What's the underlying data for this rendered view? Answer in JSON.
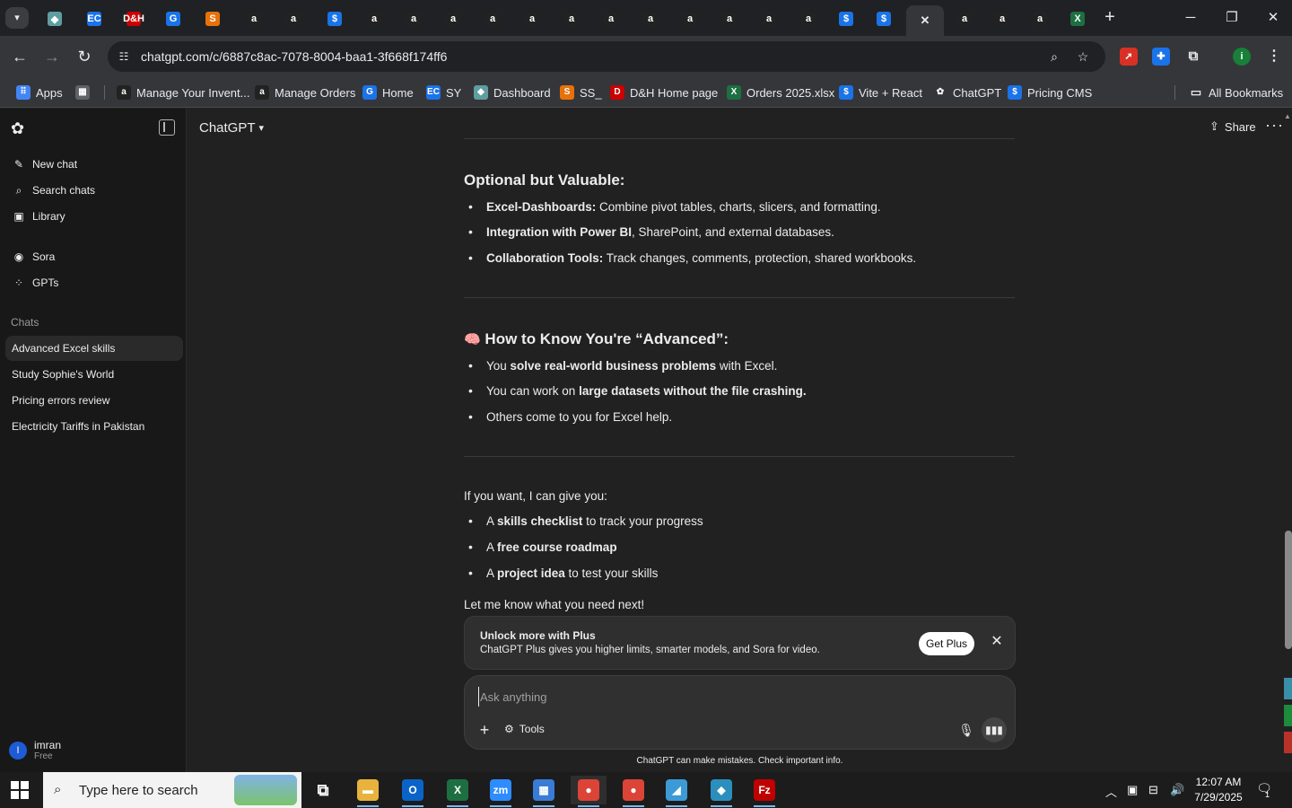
{
  "browser": {
    "url": "chatgpt.com/c/6887c8ac-7078-8004-baa1-3f668f174ff6",
    "tab_menu_icon": "chevron-down-icon",
    "new_tab_label": "+",
    "tabs": [
      {
        "icon": "app-icon",
        "label": "◆",
        "color": "#5f9ea0"
      },
      {
        "icon": "ec-icon",
        "label": "EC",
        "color": "#1a73e8"
      },
      {
        "icon": "dh-icon",
        "label": "D&H",
        "color": "#c00"
      },
      {
        "icon": "app-icon",
        "label": "G",
        "color": "#1a73e8"
      },
      {
        "icon": "app-icon",
        "label": "S",
        "color": "#e8710a"
      },
      {
        "icon": "amazon-icon",
        "label": "a",
        "color": "#222"
      },
      {
        "icon": "amazon-icon",
        "label": "a",
        "color": "#222"
      },
      {
        "icon": "dollar-icon",
        "label": "$",
        "color": "#1a73e8"
      },
      {
        "icon": "amazon-icon",
        "label": "a",
        "color": "#222"
      },
      {
        "icon": "amazon-icon",
        "label": "a",
        "color": "#222"
      },
      {
        "icon": "amazon-icon",
        "label": "a",
        "color": "#222"
      },
      {
        "icon": "amazon-icon",
        "label": "a",
        "color": "#222"
      },
      {
        "icon": "amazon-icon",
        "label": "a",
        "color": "#222"
      },
      {
        "icon": "amazon-icon",
        "label": "a",
        "color": "#222"
      },
      {
        "icon": "amazon-icon",
        "label": "a",
        "color": "#222"
      },
      {
        "icon": "amazon-icon",
        "label": "a",
        "color": "#222"
      },
      {
        "icon": "amazon-icon",
        "label": "a",
        "color": "#222"
      },
      {
        "icon": "amazon-icon",
        "label": "a",
        "color": "#222"
      },
      {
        "icon": "amazon-icon",
        "label": "a",
        "color": "#222"
      },
      {
        "icon": "amazon-icon",
        "label": "a",
        "color": "#222"
      },
      {
        "icon": "dollar-icon",
        "label": "$",
        "color": "#1a73e8"
      },
      {
        "icon": "dollar-icon",
        "label": "$",
        "color": "#1a73e8"
      },
      {
        "icon": "close-icon",
        "label": "✕",
        "color": "#35363a",
        "active": true
      },
      {
        "icon": "amazon-icon",
        "label": "a",
        "color": "#222"
      },
      {
        "icon": "amazon-icon",
        "label": "a",
        "color": "#222"
      },
      {
        "icon": "amazon-icon",
        "label": "a",
        "color": "#222"
      },
      {
        "icon": "excel-icon",
        "label": "X",
        "color": "#1d6f42"
      }
    ],
    "bookmarks": [
      {
        "label": "Apps",
        "icon": "apps-grid-icon",
        "color": "#4285f4",
        "glyph": "⠿"
      },
      {
        "label": "",
        "icon": "tab-groups-icon",
        "color": "#5f6368",
        "glyph": "▦"
      },
      {
        "label": "Manage Your Invent...",
        "icon": "amazon-icon",
        "color": "#222",
        "glyph": "a"
      },
      {
        "label": "Manage Orders",
        "icon": "amazon-icon",
        "color": "#222",
        "glyph": "a"
      },
      {
        "label": "Home",
        "icon": "home-icon",
        "color": "#1a73e8",
        "glyph": "G"
      },
      {
        "label": "SY",
        "icon": "ec-icon",
        "color": "#1a73e8",
        "glyph": "EC"
      },
      {
        "label": "Dashboard",
        "icon": "dashboard-icon",
        "color": "#5f9ea0",
        "glyph": "◆"
      },
      {
        "label": "SS_",
        "icon": "app-icon",
        "color": "#e8710a",
        "glyph": "S"
      },
      {
        "label": "D&H Home page",
        "icon": "dh-icon",
        "color": "#c00",
        "glyph": "D"
      },
      {
        "label": "Orders 2025.xlsx",
        "icon": "excel-icon",
        "color": "#1d6f42",
        "glyph": "X"
      },
      {
        "label": "Vite + React",
        "icon": "dollar-icon",
        "color": "#1a73e8",
        "glyph": "$"
      },
      {
        "label": "ChatGPT",
        "icon": "chatgpt-icon",
        "color": "#35363a",
        "glyph": "✿"
      },
      {
        "label": "Pricing CMS",
        "icon": "dollar-icon",
        "color": "#1a73e8",
        "glyph": "$"
      }
    ],
    "all_bookmarks": "All Bookmarks"
  },
  "sidebar": {
    "nav": [
      {
        "label": "New chat",
        "icon": "edit-icon",
        "glyph": "✎"
      },
      {
        "label": "Search chats",
        "icon": "search-icon",
        "glyph": "⌕"
      },
      {
        "label": "Library",
        "icon": "library-icon",
        "glyph": "▣"
      },
      {
        "label": "Sora",
        "icon": "sora-icon",
        "glyph": "◉"
      },
      {
        "label": "GPTs",
        "icon": "gpts-icon",
        "glyph": "⁘"
      }
    ],
    "chats_heading": "Chats",
    "chats": [
      "Advanced Excel skills",
      "Study Sophie's World",
      "Pricing errors review",
      "Electricity Tariffs in Pakistan"
    ],
    "user": {
      "initial": "I",
      "name": "imran",
      "plan": "Free"
    }
  },
  "header": {
    "model": "ChatGPT",
    "share": "Share"
  },
  "content": {
    "section1": {
      "heading": "Optional but Valuable:",
      "bullets": [
        {
          "bold": "Excel-Dashboards:",
          "rest": " Combine pivot tables, charts, slicers, and formatting."
        },
        {
          "bold": "Integration with Power BI",
          "rest": ", SharePoint, and external databases."
        },
        {
          "bold": "Collaboration Tools:",
          "rest": " Track changes, comments, protection, shared workbooks."
        }
      ]
    },
    "section2": {
      "emoji": "🧠",
      "heading": "How to Know You're “Advanced”:",
      "b1": {
        "pre": "You ",
        "bold": "solve real-world business problems",
        "post": " with Excel."
      },
      "b2": {
        "pre": "You can work on ",
        "bold": "large datasets without the file crashing."
      },
      "b3": "Others come to you for Excel help."
    },
    "section3": {
      "intro": "If you want, I can give you:",
      "bullets": [
        {
          "pre": "A ",
          "bold": "skills checklist",
          "post": " to track your progress"
        },
        {
          "pre": "A ",
          "bold": "free course roadmap",
          "post": ""
        },
        {
          "pre": "A ",
          "bold": "project idea",
          "post": " to test your skills"
        }
      ],
      "outro": "Let me know what you need next!"
    }
  },
  "upsell": {
    "title": "Unlock more with Plus",
    "text": "ChatGPT Plus gives you higher limits, smarter models, and Sora for video.",
    "button": "Get Plus"
  },
  "composer": {
    "placeholder": "Ask anything",
    "tools": "Tools",
    "disclaimer": "ChatGPT can make mistakes. Check important info."
  },
  "taskbar": {
    "search_placeholder": "Type here to search",
    "apps": [
      {
        "icon": "task-view-icon",
        "glyph": "⧉",
        "color": "#1c1c1c"
      },
      {
        "icon": "file-explorer-icon",
        "glyph": "▬",
        "color": "#e8b33c"
      },
      {
        "icon": "outlook-icon",
        "glyph": "O",
        "color": "#0a64c8"
      },
      {
        "icon": "excel-icon",
        "glyph": "X",
        "color": "#1d6f42"
      },
      {
        "icon": "zoom-icon",
        "glyph": "zm",
        "color": "#2d8cff"
      },
      {
        "icon": "calculator-icon",
        "glyph": "▦",
        "color": "#3a7bd5"
      },
      {
        "icon": "chrome-icon",
        "glyph": "●",
        "color": "#db4437"
      },
      {
        "icon": "chrome-icon",
        "glyph": "●",
        "color": "#db4437"
      },
      {
        "icon": "app-icon",
        "glyph": "◢",
        "color": "#3c9bd6"
      },
      {
        "icon": "app-icon",
        "glyph": "◆",
        "color": "#2a8fbd"
      },
      {
        "icon": "filezilla-icon",
        "glyph": "Fz",
        "color": "#bf0000"
      }
    ],
    "time": "12:07 AM",
    "date": "7/29/2025",
    "notifications": "1"
  }
}
